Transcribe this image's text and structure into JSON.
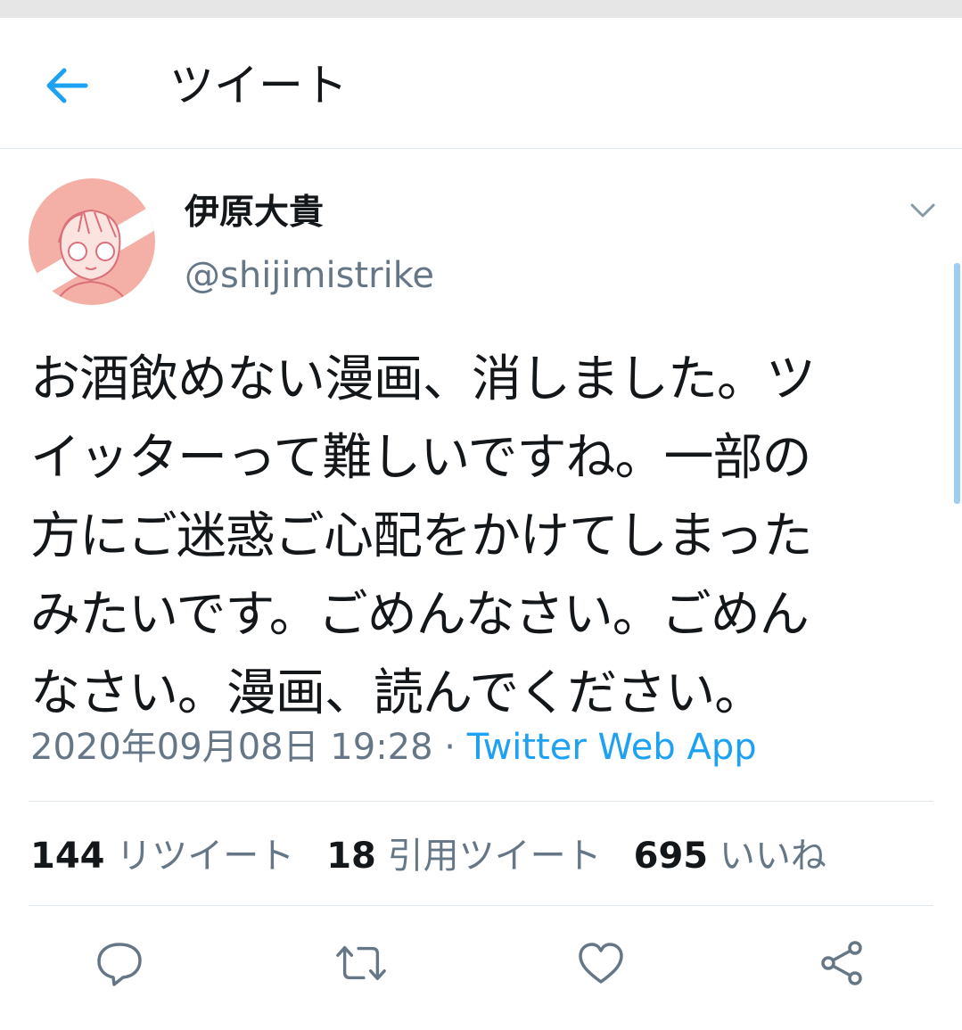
{
  "header": {
    "title": "ツイート",
    "back_icon": "arrow-left-icon"
  },
  "tweet": {
    "author_name": "伊原大貴",
    "author_handle": "@shijimistrike",
    "text": "お酒飲めない漫画、消しました。ツ\nイッターって難しいですね。一部の\n方にご迷惑ご心配をかけてしまった\nみたいです。ごめんなさい。ごめん\nなさい。漫画、読んでください。",
    "timestamp": "2020年09月08日 19:28",
    "separator": " · ",
    "source": "Twitter Web App"
  },
  "stats": {
    "retweets_count": "144",
    "retweets_label": "リツイート",
    "quotes_count": "18",
    "quotes_label": "引用ツイート",
    "likes_count": "695",
    "likes_label": "いいね"
  },
  "actions": [
    "reply-icon",
    "retweet-icon",
    "like-icon",
    "share-icon"
  ],
  "colors": {
    "accent": "#1da1f2",
    "secondary_text": "#657786",
    "divider": "#e1e8ed",
    "avatar_bg": "#f4b0a6"
  }
}
